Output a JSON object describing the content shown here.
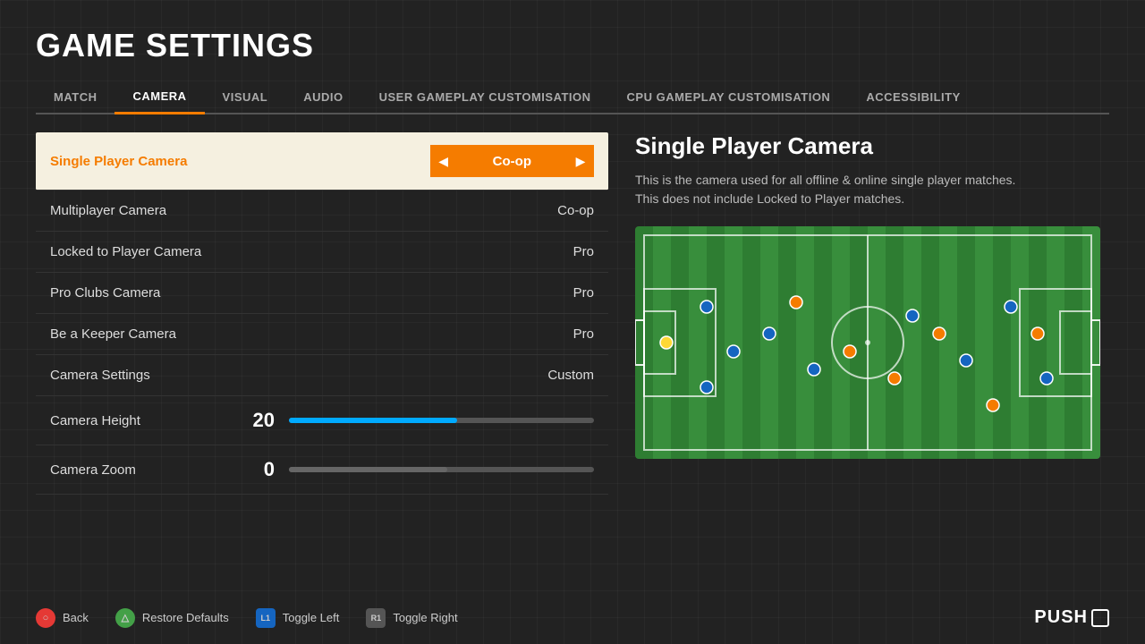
{
  "page": {
    "title": "GAME SETTINGS",
    "background_color": "#222"
  },
  "tabs": [
    {
      "id": "match",
      "label": "MATCH",
      "active": false
    },
    {
      "id": "camera",
      "label": "CAMERA",
      "active": true
    },
    {
      "id": "visual",
      "label": "VISUAL",
      "active": false
    },
    {
      "id": "audio",
      "label": "AUDIO",
      "active": false
    },
    {
      "id": "user-gameplay",
      "label": "USER GAMEPLAY CUSTOMISATION",
      "active": false
    },
    {
      "id": "cpu-gameplay",
      "label": "CPU GAMEPLAY CUSTOMISATION",
      "active": false
    },
    {
      "id": "accessibility",
      "label": "ACCESSIBILITY",
      "active": false
    }
  ],
  "settings": [
    {
      "id": "single-player-camera",
      "label": "Single Player Camera",
      "value": "Co-op",
      "active": true,
      "type": "selector"
    },
    {
      "id": "multiplayer-camera",
      "label": "Multiplayer Camera",
      "value": "Co-op",
      "active": false,
      "type": "selector"
    },
    {
      "id": "locked-to-player-camera",
      "label": "Locked to Player Camera",
      "value": "Pro",
      "active": false,
      "type": "selector"
    },
    {
      "id": "pro-clubs-camera",
      "label": "Pro Clubs Camera",
      "value": "Pro",
      "active": false,
      "type": "selector"
    },
    {
      "id": "be-a-keeper-camera",
      "label": "Be a Keeper Camera",
      "value": "Pro",
      "active": false,
      "type": "selector"
    },
    {
      "id": "camera-settings",
      "label": "Camera Settings",
      "value": "Custom",
      "active": false,
      "type": "selector"
    }
  ],
  "sliders": [
    {
      "id": "camera-height",
      "label": "Camera Height",
      "value": 20,
      "fill_percent": 55,
      "fill_color": "blue"
    },
    {
      "id": "camera-zoom",
      "label": "Camera Zoom",
      "value": 0,
      "fill_percent": 52,
      "fill_color": "gray"
    }
  ],
  "detail": {
    "title": "Single Player Camera",
    "description": "This is the camera used for all offline & online single player matches.\nThis does not include Locked to Player matches."
  },
  "toolbar": {
    "back_label": "Back",
    "restore_label": "Restore Defaults",
    "toggle_left_label": "Toggle Left",
    "toggle_right_label": "Toggle Right"
  },
  "brand": {
    "name": "PUSH"
  },
  "colors": {
    "accent": "#f57c00",
    "active_bg": "#f5f0e0",
    "slider_blue": "#00aaff",
    "tab_border": "#f57c00"
  }
}
